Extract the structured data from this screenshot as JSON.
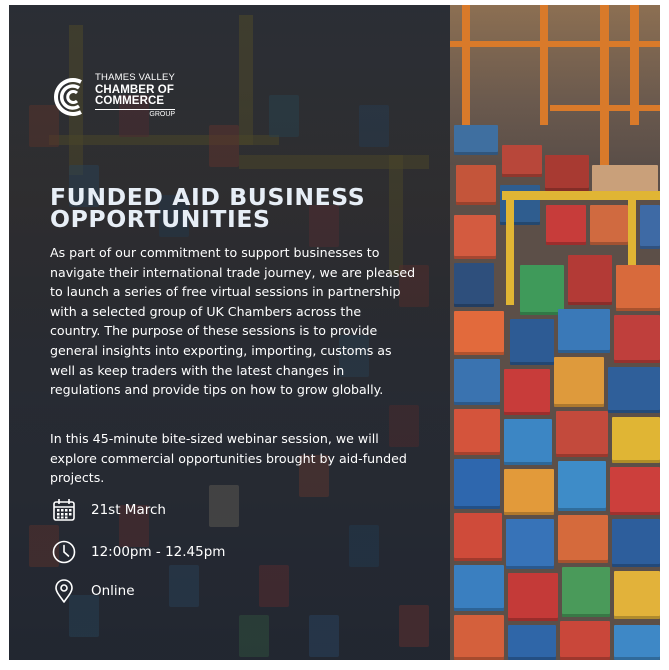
{
  "logo": {
    "line1": "THAMES VALLEY",
    "line2": "CHAMBER OF",
    "line3": "COMMERCE",
    "line4": "GROUP"
  },
  "title": {
    "line1": "FUNDED AID BUSINESS",
    "line2": "OPPORTUNITIES"
  },
  "intro_lines": [
    "As part of our commitment to support businesses to",
    "navigate their international trade journey, we are pleased",
    "to launch a series of free virtual sessions in partnership",
    "with a selected group of UK Chambers across the",
    "country. The purpose of these sessions is to provide",
    "general insights into exporting, importing, customs as",
    "well as keep traders with the latest changes in",
    "regulations and provide tips on how to grow globally."
  ],
  "session_lines": [
    "In this 45-minute bite-sized webinar session, we will",
    "explore commercial opportunities brought by aid-funded",
    "projects."
  ],
  "details": {
    "date": "21st March",
    "time": "12:00pm - 12.45pm",
    "location": "Online",
    "date_icon": "calendar-icon",
    "time_icon": "clock-icon",
    "location_icon": "location-pin-icon"
  },
  "colors": {
    "title": "#e7eef6",
    "text": "#ffffff",
    "overlay": "#1e222a",
    "crane_yellow": "#e0b534"
  }
}
